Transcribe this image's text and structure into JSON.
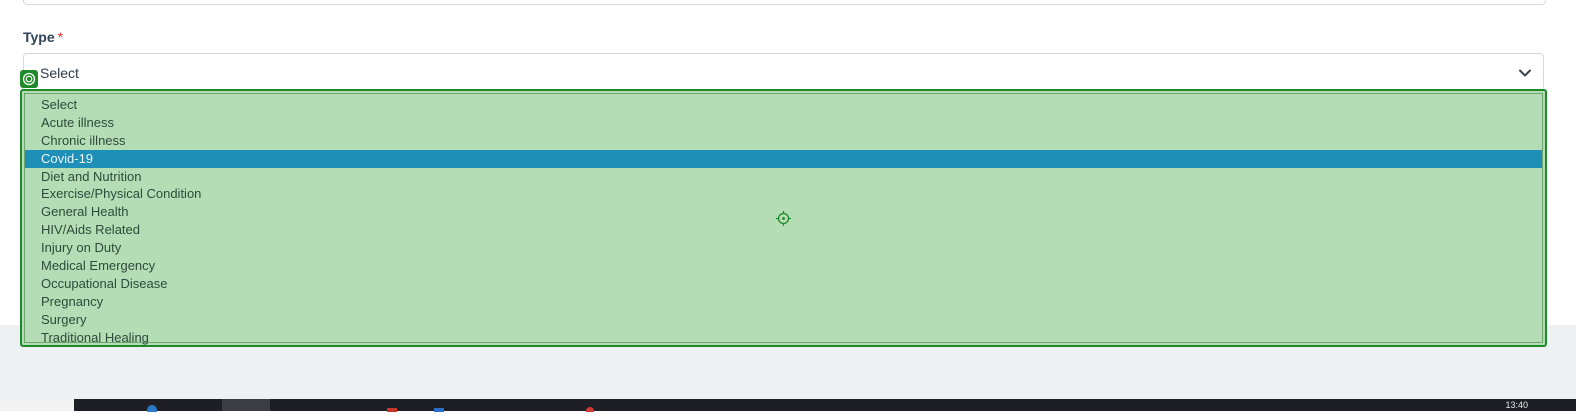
{
  "form": {
    "type_field": {
      "label": "Type",
      "required_mark": "*",
      "value": "Select"
    }
  },
  "dropdown": {
    "selected_index": 3,
    "options": [
      "Select",
      "Acute illness",
      "Chronic illness",
      "Covid-19",
      "Diet and Nutrition",
      "Exercise/Physical Condition",
      "General Health",
      "HIV/Aids Related",
      "Injury on Duty",
      "Medical Emergency",
      "Occupational Disease",
      "Pregnancy",
      "Surgery",
      "Traditional Healing"
    ]
  },
  "taskbar": {
    "clock": "13:40"
  },
  "colors": {
    "highlight_green": "#b4ddb5",
    "highlight_border": "#1e8a2a",
    "selected_option": "#1e8fb7",
    "required": "#d9322f"
  },
  "icons": {
    "marker": "target-marker-icon",
    "center": "crosshair-icon",
    "dropdown_arrow": "chevron-down-icon"
  }
}
